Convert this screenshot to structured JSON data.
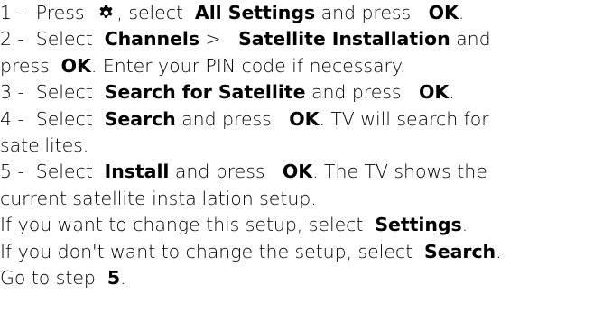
{
  "steps": [
    {
      "num": "1 -",
      "t1": "Press",
      "t2": ", select",
      "b1": "All Settings",
      "t3": "and press",
      "b2": "OK",
      "t4": "."
    },
    {
      "num": "2 -",
      "t1": "Select",
      "b1": "Channels",
      "t2": ">",
      "b2": "Satellite Installation",
      "t3": "and",
      "t4": "press",
      "b3": "OK",
      "t5": ". Enter your PIN code if necessary."
    },
    {
      "num": "3 -",
      "t1": "Select",
      "b1": "Search for Satellite",
      "t2": "and press",
      "b2": "OK",
      "t3": "."
    },
    {
      "num": "4 -",
      "t1": "Select",
      "b1": "Search",
      "t2": "and press",
      "b2": "OK",
      "t3": ". TV will search for",
      "t4": "satellites."
    },
    {
      "num": "5 -",
      "t1": "Select",
      "b1": "Install",
      "t2": "and press",
      "b2": "OK",
      "t3": ". The TV shows the",
      "t4": "current satellite installation setup."
    }
  ],
  "note1": {
    "t1": "If you want to change this setup, select",
    "b1": "Settings",
    "t2": "."
  },
  "note2": {
    "t1": "If you don't want to change the setup, select",
    "b1": "Search",
    "t2": "."
  },
  "note3": {
    "t1": "Go to step",
    "b1": "5",
    "t2": "."
  },
  "icons": {
    "settings": "gear-icon"
  }
}
